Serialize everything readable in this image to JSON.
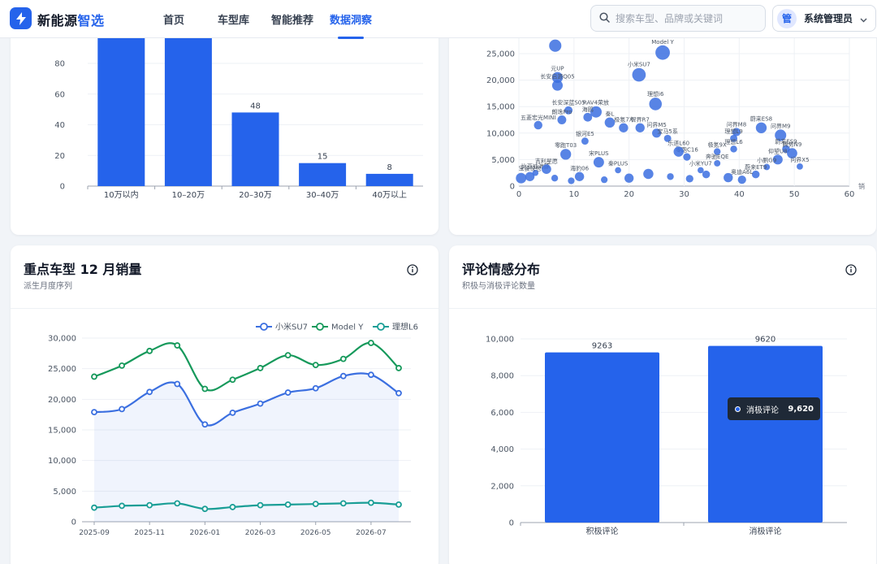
{
  "header": {
    "brand_part1": "新能源",
    "brand_part2": "智选",
    "nav": [
      {
        "label": "首页",
        "active": false
      },
      {
        "label": "车型库",
        "active": false
      },
      {
        "label": "智能推荐",
        "active": false
      },
      {
        "label": "数据洞察",
        "active": true
      }
    ],
    "search_placeholder": "搜索车型、品牌或关键词",
    "user_avatar": "管",
    "user_name": "系统管理员"
  },
  "colors": {
    "accent": "#2563eb",
    "series": [
      "#3b6fe0",
      "#16995b",
      "#1a9e96"
    ]
  },
  "price_chart": {
    "chart_data": {
      "type": "bar",
      "categories": [
        "10万以内",
        "10–20万",
        "20–30万",
        "30–40万",
        "40万以上"
      ],
      "values": [
        110,
        110,
        48,
        15,
        8
      ],
      "labels": [
        "",
        "",
        "48",
        "15",
        "8"
      ],
      "yticks": [
        "0",
        "20",
        "40",
        "60",
        "80"
      ],
      "ylim": [
        0,
        100
      ]
    }
  },
  "scatter_chart": {
    "axis_tail": "销",
    "chart_data": {
      "type": "scatter",
      "xticks": [
        "0",
        "10",
        "20",
        "30",
        "40",
        "50",
        "60"
      ],
      "yticks": [
        "0",
        "5,000",
        "10,000",
        "15,000",
        "20,000",
        "25,000"
      ],
      "xlim": [
        0,
        60
      ],
      "ylim": [
        0,
        28000
      ],
      "points": [
        {
          "x": 26.1,
          "y": 25200,
          "label": "Model Y"
        },
        {
          "x": 6.6,
          "y": 26500,
          "label": ""
        },
        {
          "x": 21.8,
          "y": 21000,
          "label": "小米SU7"
        },
        {
          "x": 7.0,
          "y": 20500,
          "label": "元UP"
        },
        {
          "x": 7.0,
          "y": 19000,
          "label": "长安启源Q05"
        },
        {
          "x": 24.8,
          "y": 15500,
          "label": "理想i6"
        },
        {
          "x": 9.0,
          "y": 14300,
          "label": "长安深蓝S05"
        },
        {
          "x": 14.0,
          "y": 14000,
          "label": "RAV4荣放"
        },
        {
          "x": 12.5,
          "y": 13000,
          "label": "海鸥"
        },
        {
          "x": 7.8,
          "y": 12500,
          "label": "朗逸Pro"
        },
        {
          "x": 3.5,
          "y": 11500,
          "label": "五菱宏光MINI"
        },
        {
          "x": 19.0,
          "y": 11000,
          "label": "极氪7X"
        },
        {
          "x": 16.5,
          "y": 12000,
          "label": "秦L"
        },
        {
          "x": 22.0,
          "y": 11000,
          "label": "智界R7"
        },
        {
          "x": 25.0,
          "y": 10000,
          "label": "问界M5"
        },
        {
          "x": 44.0,
          "y": 11000,
          "label": "蔚来ES8"
        },
        {
          "x": 47.5,
          "y": 9600,
          "label": "问界M9"
        },
        {
          "x": 39.5,
          "y": 10200,
          "label": "问界M8"
        },
        {
          "x": 39.0,
          "y": 9000,
          "label": "理想L9"
        },
        {
          "x": 48.5,
          "y": 7000,
          "label": "蔚来ES9"
        },
        {
          "x": 27.0,
          "y": 9000,
          "label": "宝马5系"
        },
        {
          "x": 39.0,
          "y": 7000,
          "label": "理想L6"
        },
        {
          "x": 36.0,
          "y": 6500,
          "label": "极氪9X"
        },
        {
          "x": 49.6,
          "y": 6200,
          "label": "腾势N9"
        },
        {
          "x": 47.0,
          "y": 5000,
          "label": "仰望U8"
        },
        {
          "x": 51.0,
          "y": 3700,
          "label": "问界X5"
        },
        {
          "x": 45.0,
          "y": 3600,
          "label": "小鹏G9"
        },
        {
          "x": 43.0,
          "y": 2200,
          "label": "蔚来ET9"
        },
        {
          "x": 40.5,
          "y": 1200,
          "label": "奥迪A6L"
        },
        {
          "x": 36.0,
          "y": 4300,
          "label": "奔驰EQE"
        },
        {
          "x": 33.0,
          "y": 3000,
          "label": "小米YU7"
        },
        {
          "x": 30.5,
          "y": 5500,
          "label": "零跑C16"
        },
        {
          "x": 29.0,
          "y": 6500,
          "label": "乐道L60"
        },
        {
          "x": 3.0,
          "y": 2500,
          "label": "比亚迪海豚"
        },
        {
          "x": 2.0,
          "y": 1800,
          "label": "宝骏悦也"
        },
        {
          "x": 0.4,
          "y": 1500,
          "label": ""
        },
        {
          "x": 5.0,
          "y": 3200,
          "label": "吉利星愿"
        },
        {
          "x": 8.5,
          "y": 6000,
          "label": "零跑T03"
        },
        {
          "x": 12.0,
          "y": 8500,
          "label": "银河E5"
        },
        {
          "x": 14.5,
          "y": 4500,
          "label": "宋PLUS"
        },
        {
          "x": 18.0,
          "y": 3000,
          "label": "秦PLUS"
        },
        {
          "x": 11.0,
          "y": 1800,
          "label": "海豹06"
        },
        {
          "x": 6.5,
          "y": 1500,
          "label": ""
        },
        {
          "x": 9.5,
          "y": 1000,
          "label": ""
        },
        {
          "x": 15.5,
          "y": 1200,
          "label": ""
        },
        {
          "x": 20.0,
          "y": 1500,
          "label": ""
        },
        {
          "x": 23.5,
          "y": 2300,
          "label": ""
        },
        {
          "x": 27.5,
          "y": 1800,
          "label": ""
        },
        {
          "x": 31.0,
          "y": 1400,
          "label": ""
        },
        {
          "x": 34.0,
          "y": 2200,
          "label": ""
        },
        {
          "x": 38.0,
          "y": 1600,
          "label": ""
        }
      ]
    }
  },
  "sales_chart": {
    "title": "重点车型 12 月销量",
    "subtitle": "派生月度序列",
    "legend": [
      "小米SU7",
      "Model Y",
      "理想L6"
    ],
    "chart_data": {
      "type": "line",
      "x": [
        "2025-09",
        "2025-10",
        "2025-11",
        "2025-12",
        "2026-01",
        "2026-02",
        "2026-03",
        "2026-04",
        "2026-05",
        "2026-06",
        "2026-07",
        "2026-08"
      ],
      "xticks": [
        "2025-09",
        "2025-11",
        "2026-01",
        "2026-03",
        "2026-05",
        "2026-07"
      ],
      "yticks": [
        "0",
        "5,000",
        "10,000",
        "15,000",
        "20,000",
        "25,000",
        "30,000"
      ],
      "ylim": [
        0,
        30000
      ],
      "series": [
        {
          "name": "小米SU7",
          "values": [
            17900,
            18400,
            21200,
            22500,
            15900,
            17800,
            19300,
            21100,
            21800,
            23800,
            24000,
            21000
          ]
        },
        {
          "name": "Model Y",
          "values": [
            23700,
            25500,
            27900,
            28800,
            21700,
            23200,
            25100,
            27200,
            25600,
            26600,
            29200,
            25100
          ]
        },
        {
          "name": "理想L6",
          "values": [
            2300,
            2600,
            2700,
            3000,
            2100,
            2400,
            2700,
            2800,
            2900,
            3000,
            3100,
            2800
          ]
        }
      ]
    }
  },
  "sentiment_chart": {
    "title": "评论情感分布",
    "subtitle": "积极与消极评论数量",
    "tooltip": {
      "label": "消极评论",
      "value": "9,620"
    },
    "chart_data": {
      "type": "bar",
      "categories": [
        "积极评论",
        "消极评论"
      ],
      "values": [
        9263,
        9620
      ],
      "labels": [
        "9263",
        "9620"
      ],
      "yticks": [
        "0",
        "2,000",
        "4,000",
        "6,000",
        "8,000",
        "10,000"
      ],
      "ylim": [
        0,
        11000
      ]
    }
  }
}
